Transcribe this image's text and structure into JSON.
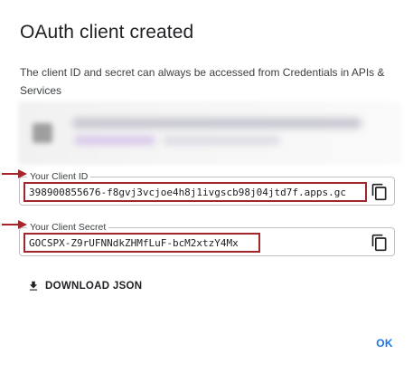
{
  "dialog": {
    "title": "OAuth client created",
    "description": "The client ID and secret can always be accessed from Credentials in APIs & Services"
  },
  "client_id": {
    "label": "Your Client ID",
    "value": "398900855676-f8gvj3vcjoe4h8j1ivgscb98j04jtd7f.apps.gc",
    "copy_icon": "copy-icon"
  },
  "client_secret": {
    "label": "Your Client Secret",
    "value": "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",
    "copy_icon": "copy-icon"
  },
  "actions": {
    "download_label": "DOWNLOAD JSON",
    "download_icon": "download-icon",
    "ok_label": "OK"
  },
  "colors": {
    "highlight": "#a4262c",
    "accent": "#1a73e8"
  }
}
